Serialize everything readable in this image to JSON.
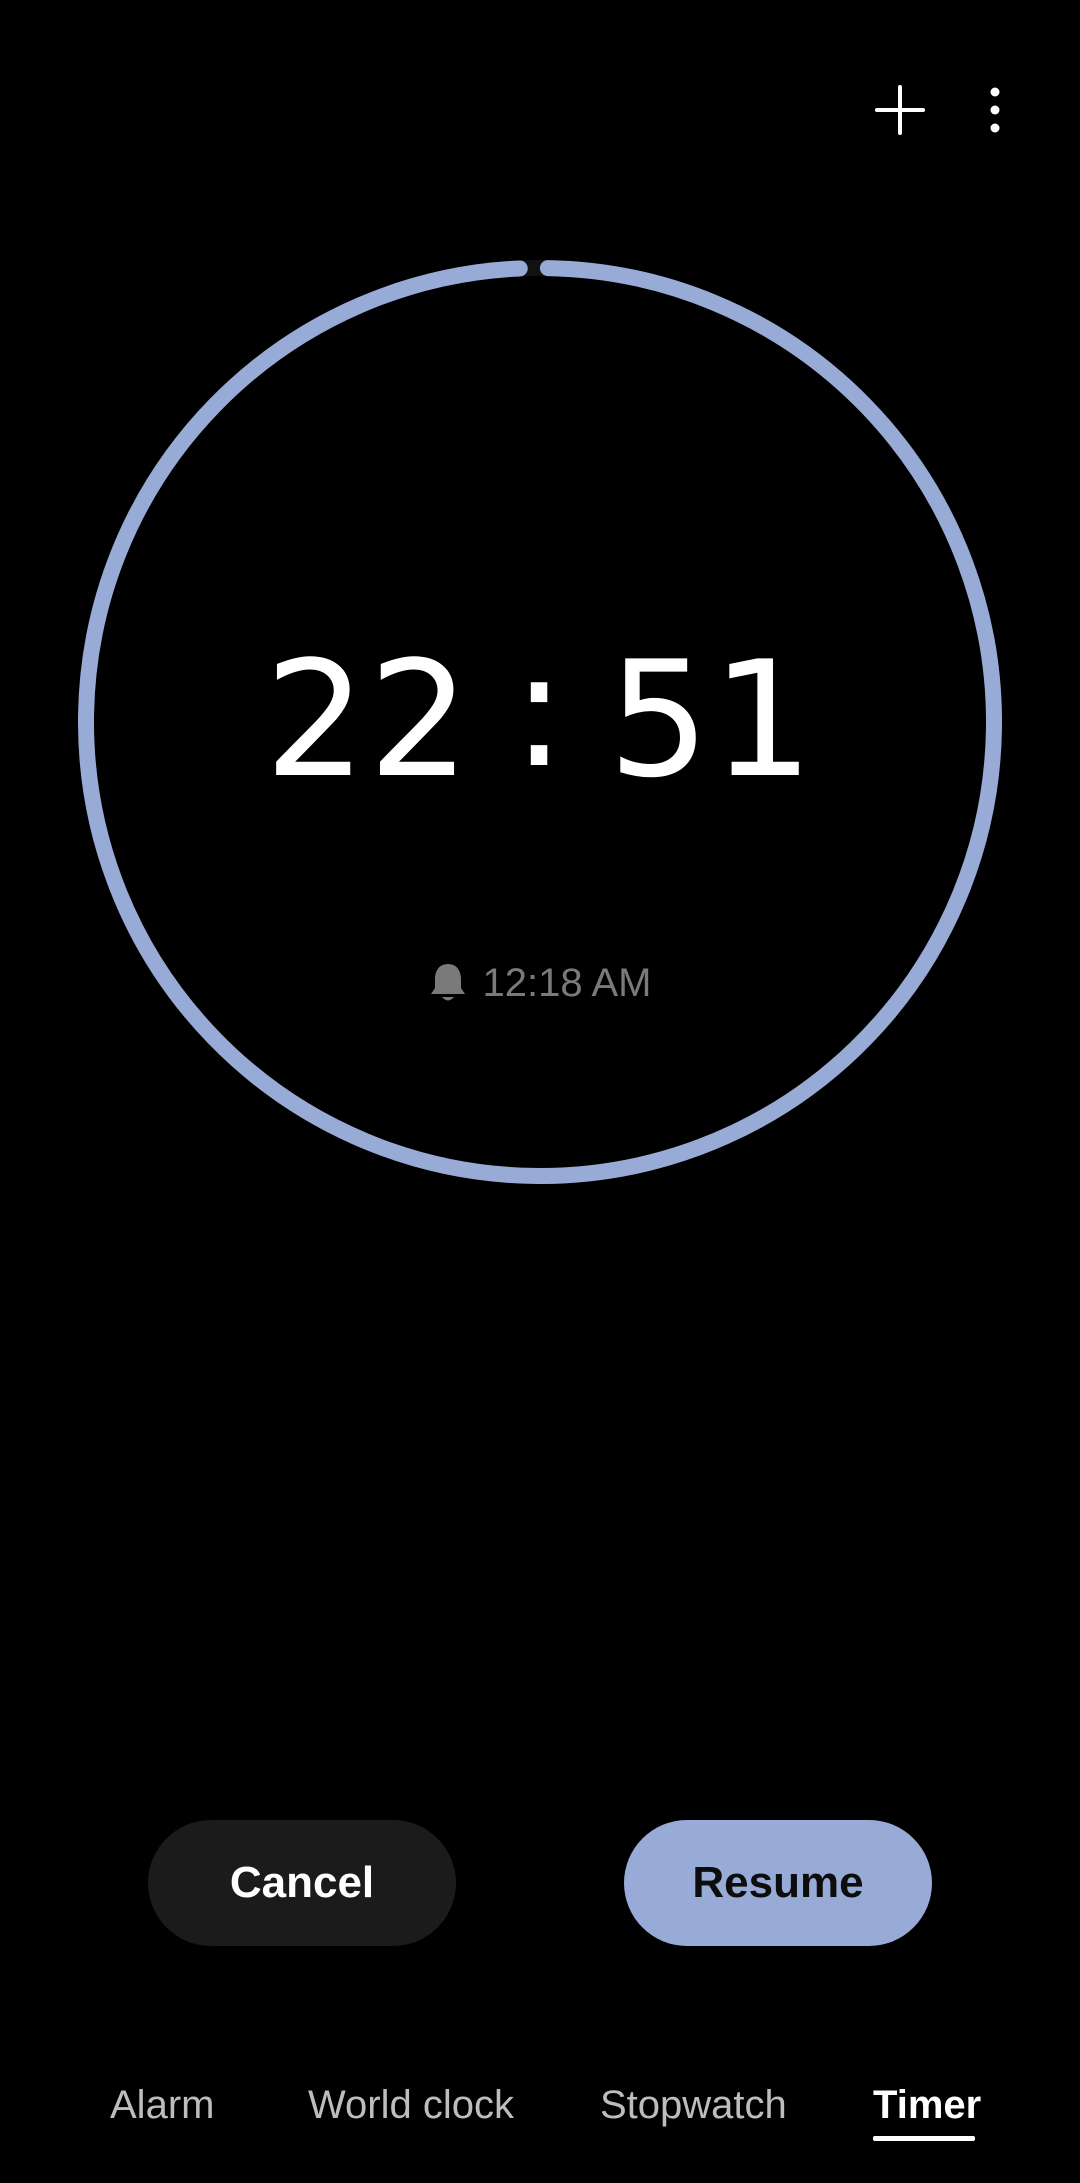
{
  "toolbar": {
    "add_icon": "plus-icon",
    "more_icon": "more-vertical-icon"
  },
  "timer": {
    "minutes": "22",
    "separator": ":",
    "seconds": "51",
    "end_time": "12:18 AM",
    "end_icon": "bell-icon",
    "ring_color": "#98aad6",
    "progress": 0.99
  },
  "actions": {
    "cancel_label": "Cancel",
    "resume_label": "Resume"
  },
  "tabs": [
    {
      "label": "Alarm",
      "active": false
    },
    {
      "label": "World clock",
      "active": false
    },
    {
      "label": "Stopwatch",
      "active": false
    },
    {
      "label": "Timer",
      "active": true
    }
  ]
}
